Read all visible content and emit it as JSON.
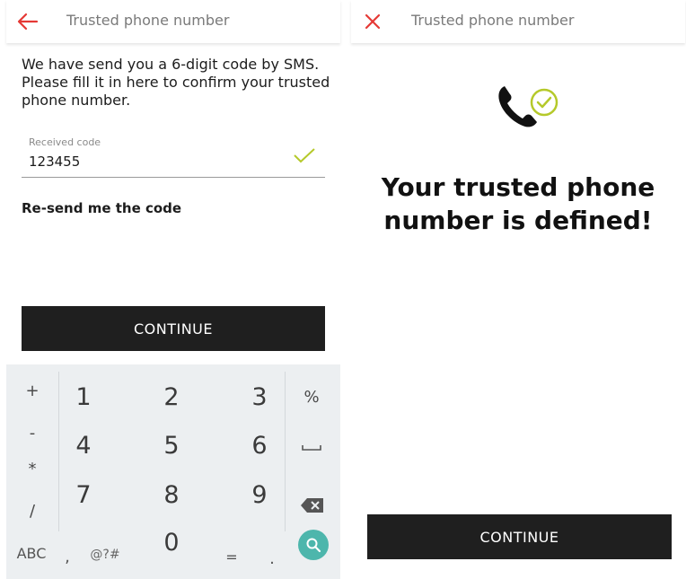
{
  "left_screen": {
    "header_title": "Trusted phone number",
    "nav_icon": "back-arrow-icon",
    "instructions": "We have send you a 6-digit code by SMS. Please fill it in here to confirm your trusted phone number.",
    "code_field": {
      "label": "Received code",
      "value": "123455",
      "status_icon": "check-icon"
    },
    "resend_link": "Re-send me the code",
    "continue_label": "CONTINUE",
    "keyboard": {
      "left_column": [
        "+",
        "-",
        "*",
        "/"
      ],
      "digits": [
        "1",
        "2",
        "3",
        "4",
        "5",
        "6",
        "7",
        "8",
        "9",
        "0"
      ],
      "right_column": [
        "%"
      ],
      "bottom_row": [
        "ABC",
        ",",
        "@?#",
        "=",
        "."
      ],
      "backspace_icon": "backspace-icon",
      "space_icon": "space-icon",
      "search_icon": "search-icon"
    }
  },
  "right_screen": {
    "header_title": "Trusted phone number",
    "nav_icon": "close-icon",
    "success_icon": "phone-check-icon",
    "message": "Your trusted phone number is defined!",
    "continue_label": "CONTINUE"
  },
  "colors": {
    "accent_red": "#e53935",
    "check_green": "#b5c92a",
    "button_dark": "#1f1f1f",
    "keyboard_bg": "#eceff1",
    "search_teal": "#4db6ac"
  }
}
